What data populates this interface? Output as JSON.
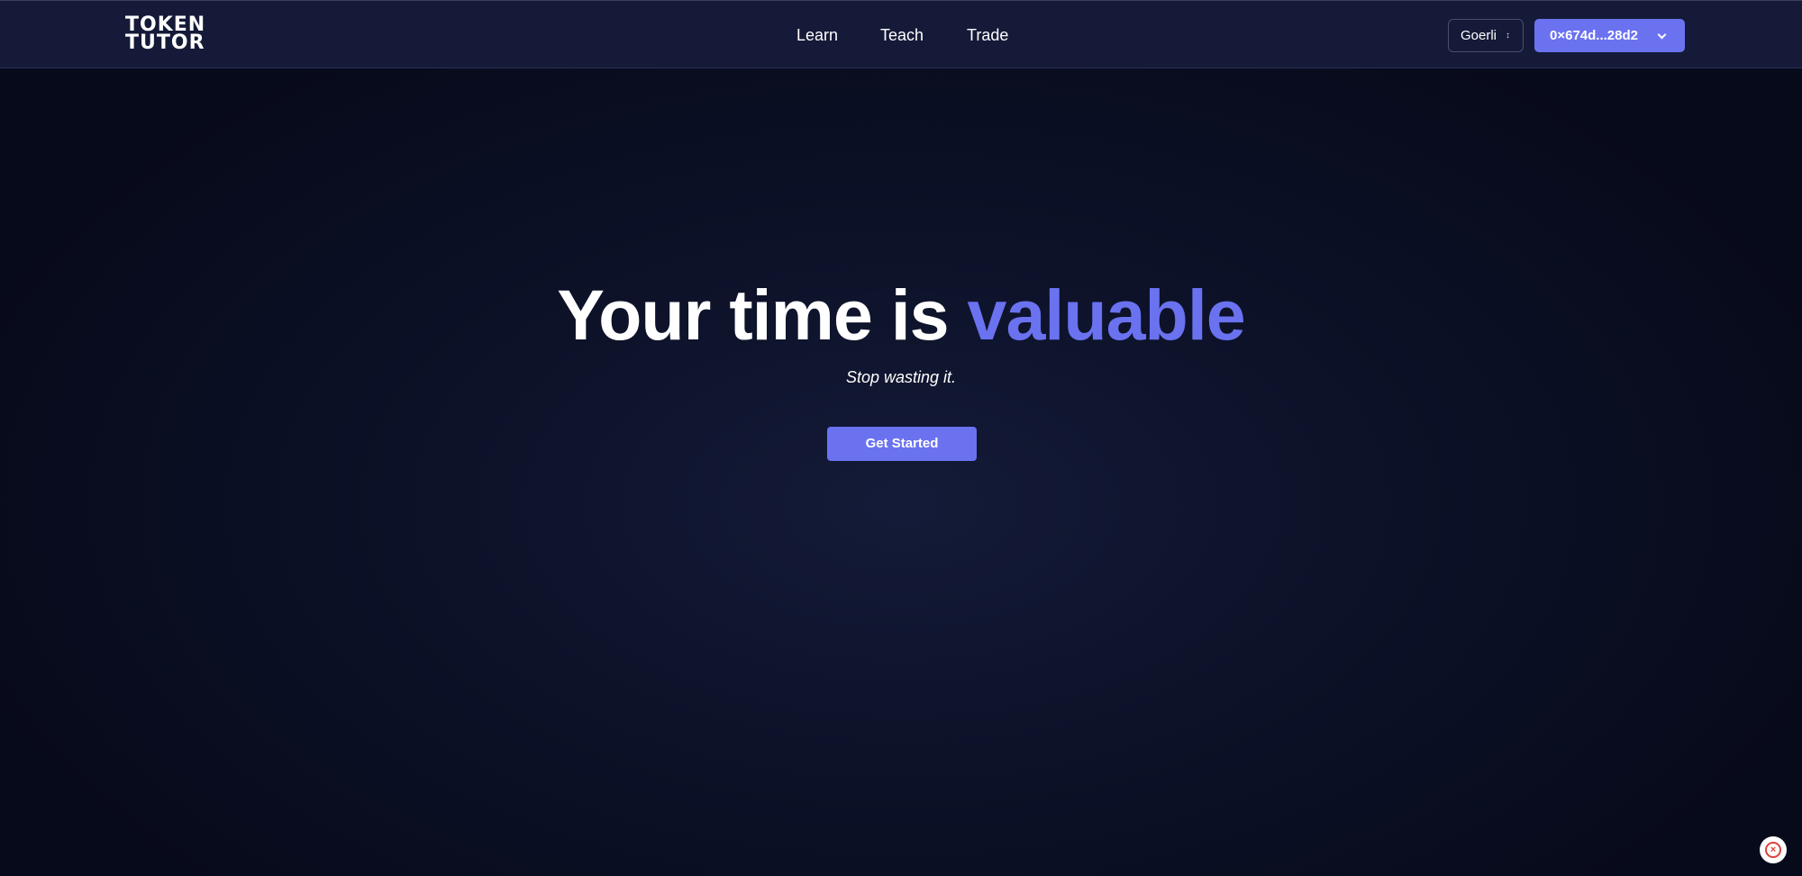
{
  "header": {
    "logo": {
      "line1": "TOKEN",
      "line2": "TUTOR"
    },
    "nav": [
      {
        "label": "Learn"
      },
      {
        "label": "Teach"
      },
      {
        "label": "Trade"
      }
    ],
    "network": {
      "selected": "Goerli"
    },
    "wallet": {
      "address": "0×674d...28d2"
    }
  },
  "hero": {
    "title_main": "Your time is",
    "title_accent": "valuable",
    "subtitle": "Stop wasting it.",
    "cta_label": "Get Started"
  },
  "colors": {
    "accent": "#6a72f0",
    "header_bg": "#151a38",
    "page_bg": "#0b1026",
    "helper_icon": "#e0413a"
  },
  "icons": {
    "network_selector": "updown-chevron-icon",
    "wallet_menu": "chevron-down-icon",
    "floating_helper": "close-circle-icon"
  }
}
